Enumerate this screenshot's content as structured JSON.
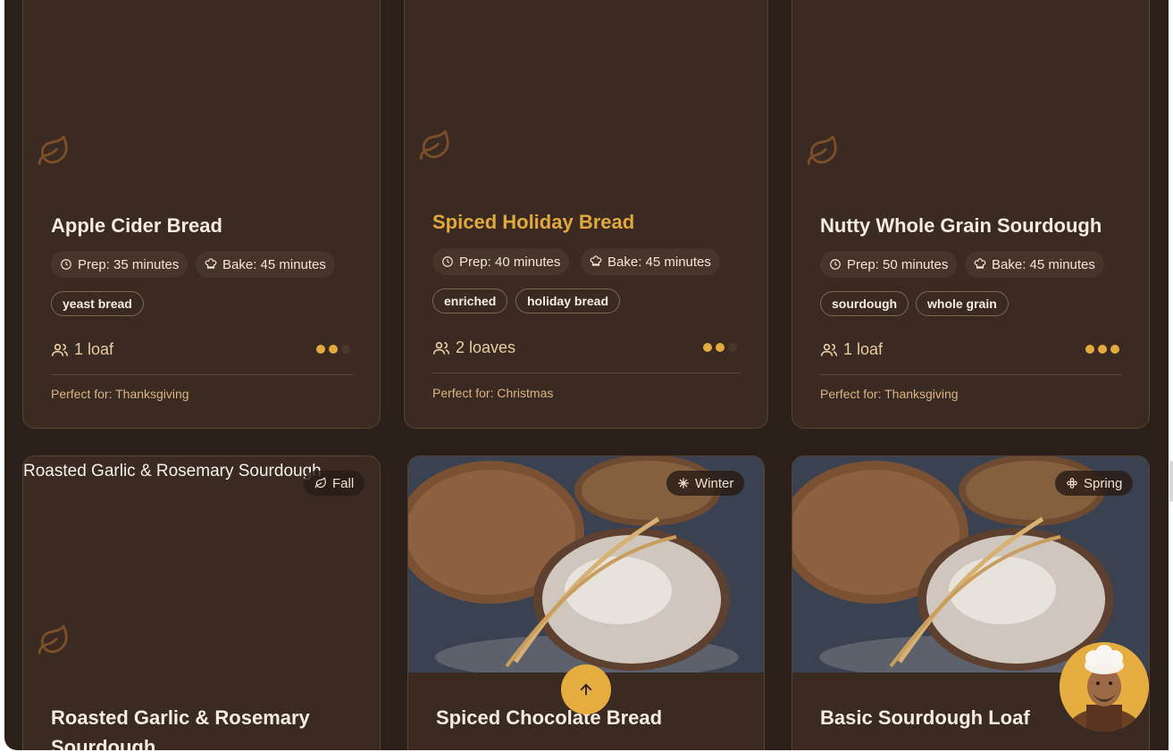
{
  "colors": {
    "background": "#2b1f1a",
    "card": "#3a2a21",
    "accent": "#e3ab3f",
    "title": "#f6ece0",
    "title_highlight": "#e0a83d",
    "muted": "#d9b487"
  },
  "cards": [
    {
      "title": "Apple Cider Bread",
      "prep": "Prep: 35 minutes",
      "bake": "Bake: 45 minutes",
      "tags": [
        "yeast bread"
      ],
      "servings": "1 loaf",
      "difficulty": 2,
      "difficulty_max": 3,
      "occasion": "Perfect for: Thanksgiving",
      "image_icon": "leaf-icon"
    },
    {
      "title": "Spiced Holiday Bread",
      "prep": "Prep: 40 minutes",
      "bake": "Bake: 45 minutes",
      "tags": [
        "enriched",
        "holiday bread"
      ],
      "servings": "2 loaves",
      "difficulty": 2,
      "difficulty_max": 3,
      "occasion": "Perfect for: Christmas",
      "image_icon": "leaf-icon",
      "hovered": true
    },
    {
      "title": "Nutty Whole Grain Sourdough",
      "prep": "Prep: 50 minutes",
      "bake": "Bake: 45 minutes",
      "tags": [
        "sourdough",
        "whole grain"
      ],
      "servings": "1 loaf",
      "difficulty": 3,
      "difficulty_max": 3,
      "occasion": "Perfect for: Thanksgiving",
      "image_icon": "leaf-icon"
    },
    {
      "title_line1": "Roasted Garlic & Rosemary",
      "title_line2": "Sourdough",
      "image_alt": "Roasted Garlic & Rosemary Sourdough",
      "season": "Fall",
      "season_icon": "leaf-icon",
      "image_icon": "leaf-icon"
    },
    {
      "title": "Spiced Chocolate Bread",
      "season": "Winter",
      "season_icon": "snowflake-icon"
    },
    {
      "title": "Basic Sourdough Loaf",
      "season": "Spring",
      "season_icon": "flower-icon"
    }
  ],
  "icons": {
    "prep": "clock-icon",
    "bake": "chef-hat-icon",
    "servings": "users-icon",
    "scroll_top": "arrow-up-icon",
    "assistant": "chef-avatar"
  }
}
